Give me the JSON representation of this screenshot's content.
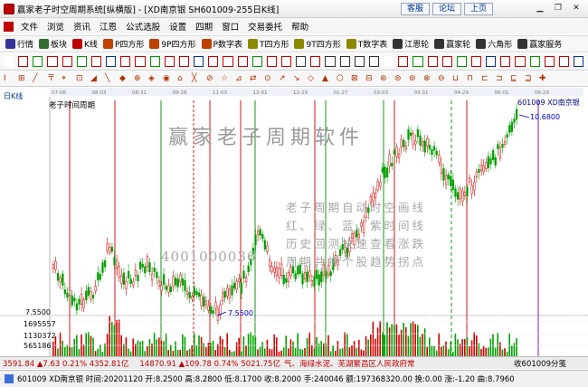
{
  "window": {
    "title": "赢家老子时空周期系统[纵横版] - [XD南京银  SH601009-255日K线]",
    "links": [
      "客服",
      "论坛",
      "上页"
    ]
  },
  "menu": [
    "文件",
    "浏览",
    "资讯",
    "江恩",
    "公式选股",
    "设置",
    "四期",
    "窗口",
    "交易委托",
    "帮助"
  ],
  "toolbar": [
    {
      "label": "行情",
      "color": "#333399"
    },
    {
      "label": "板块",
      "color": "#2f6e2f"
    },
    {
      "label": "K线",
      "color": "#c00000"
    },
    {
      "label": "P四方形",
      "color": "#c04000"
    },
    {
      "label": "9P四方形",
      "color": "#c04000"
    },
    {
      "label": "P数字表",
      "color": "#c04000"
    },
    {
      "label": "T四方形",
      "color": "#8a8a00"
    },
    {
      "label": "9T四方形",
      "color": "#8a8a00"
    },
    {
      "label": "T数字表",
      "color": "#8a8a00"
    },
    {
      "label": "江恩轮",
      "color": "#333333"
    },
    {
      "label": "赢家轮",
      "color": "#333333"
    },
    {
      "label": "六角形",
      "color": "#333333"
    },
    {
      "label": "赢家服务",
      "color": "#333333"
    }
  ],
  "chart": {
    "period_label": "日K线",
    "indicator_title": "老子时间周期",
    "stock_label": "601009  XD南京银",
    "high_label": "10.6800",
    "low_label": "7.5500",
    "axis_low": "7.5500",
    "volume_ticks": [
      "1695557",
      "1130372",
      "565186"
    ],
    "dates": [
      "07-06",
      "08-03",
      "08-31",
      "09-28",
      "11-03",
      "12-01",
      "12-29",
      "01-27",
      "03-03",
      "03-31",
      "04-29",
      "06-01",
      "06-29"
    ],
    "watermark": "赢家老子周期软件",
    "promo_lines": [
      "老子周期自动时空画线",
      "红、绿、蓝、紫时间线",
      "历史回测快速查看涨跌",
      "周期共振个股趋势拐点"
    ],
    "phone": "4001000036"
  },
  "chart_data": {
    "type": "candlestick",
    "title": "XD南京银 SH601009 日K线",
    "x_range": [
      "07-06",
      "06-29"
    ],
    "ylim": [
      7.55,
      10.68
    ],
    "marked_high": 10.68,
    "marked_low": 7.55,
    "volume_ticks": [
      565186,
      1130372,
      1695557
    ]
  },
  "status1": {
    "index1": "3591.84 ▲7.63 0.21% 4352.81亿",
    "index2": "14870.91 ▲109.78 0.74% 5021.75亿",
    "ticker": "气、海绿水泥、芜湖繁昌区人民政府常",
    "right": "收601009分笺"
  },
  "status2": {
    "text": "601009 XD南京银 时间:20201120 开:8.2500 高:8.2800 低:8.1700 收:8.2000 手:240046 额:197368320.00 换:0.00 涨:-1.20 曲:8.7960"
  }
}
